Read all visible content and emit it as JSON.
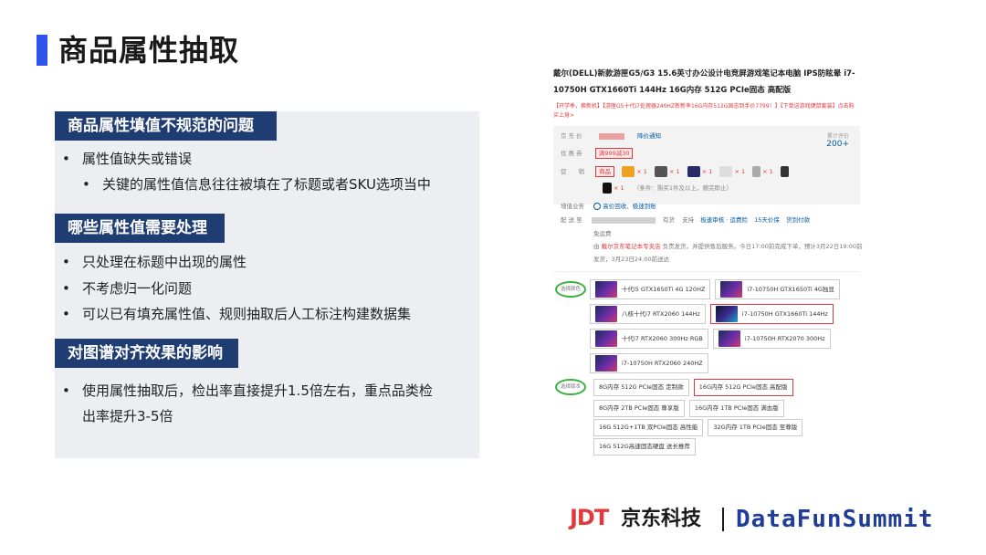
{
  "slide": {
    "title": "商品属性抽取"
  },
  "sections": [
    {
      "header": "商品属性填值不规范的问题",
      "bullets": [
        "属性值缺失或错误"
      ],
      "sub_bullets": [
        "关键的属性值信息往往被填在了标题或者SKU选项当中"
      ]
    },
    {
      "header": "哪些属性值需要处理",
      "bullets": [
        "只处理在标题中出现的属性",
        "不考虑归一化问题",
        "可以已有填充属性值、规则抽取后人工标注构建数据集"
      ]
    },
    {
      "header": "对图谱对齐效果的影响",
      "bullets": [
        "使用属性抽取后，检出率直接提升1.5倍左右，重点品类检出率提升3-5倍"
      ]
    }
  ],
  "bullet_symbol": "•",
  "product": {
    "title": "戴尔(DELL)新款游匣G5/G3 15.6英寸办公设计电竞屏游戏笔记本电脑 IPS防眩晕 i7-10750H GTX1660Ti 144Hz 16G内存 512G PCIe固态 高配版",
    "promo": "【开学季，换新机】【游匣G5十代i7处理器240HZ新新率16G内存512G固态到手价7799！】【下单送游戏键鼠套装】点击购买上身>",
    "price_label": "京 东 价",
    "price_notice": "降价通知",
    "coupon_label": "优 惠 券",
    "coupon_value": "满999减30",
    "gift_label": "促　　销",
    "gift_tag": "商品",
    "gift_count": "× 1",
    "gift_note": "（条件：购买1件及以上，赠完即止）",
    "rating_label": "累计评价",
    "rating_value": "200+",
    "service_label": "增值业务",
    "service_value": "高价回收、极速到账",
    "delivery_label": "配 送 至",
    "delivery_items": [
      "有货",
      "支持",
      "极速审核",
      "·",
      "运费险",
      "15天价保",
      "货到付款"
    ],
    "shipping_label": "免运费",
    "shipping_text_1": "由",
    "shipping_shop": "戴尔京东笔记本专卖店",
    "shipping_text_2": "负责发货，并提供售后服务。今日17:00前完成下单，预计3月22日19:00前发货，3月23日24:00前送达",
    "color_oval": "选择颜色",
    "version_oval": "选择版本",
    "colors": [
      [
        "十代i5 GTX1650Ti 4G 120HZ",
        "i7-10750H GTX1650Ti 4G独显"
      ],
      [
        "八核十代i7 RTX2060 144Hz",
        "i7-10750H GTX1660Ti 144Hz"
      ],
      [
        "十代i7 RTX2060 300Hz RGB",
        "i7-10750H RTX2070 300Hz"
      ],
      [
        "i7-10750H RTX2060 240HZ"
      ]
    ],
    "versions": [
      [
        "8G内存 512G PCIe固态 定制款",
        "16G内存 512G PCIe固态 高配版"
      ],
      [
        "8G内存 2TB PCIe固态 尊享版",
        "16G内存 1TB PCIe固态 满血版"
      ],
      [
        "16G 512G+1TB 双PCIe固态 高性能",
        "32G内存 1TB PCIe固态 至尊版"
      ],
      [
        "16G 512G高速固态硬盘 送长推荐"
      ]
    ]
  },
  "footer": {
    "jdt": "JDT",
    "jd_cn": "京东科技",
    "summit": "DataFunSummit"
  },
  "colors": {
    "accent": "#2f54eb",
    "header_bg": "#1f3c73",
    "panel_bg": "#eceef2",
    "jd_red": "#e4393c",
    "summit_blue": "#1f3c99"
  }
}
